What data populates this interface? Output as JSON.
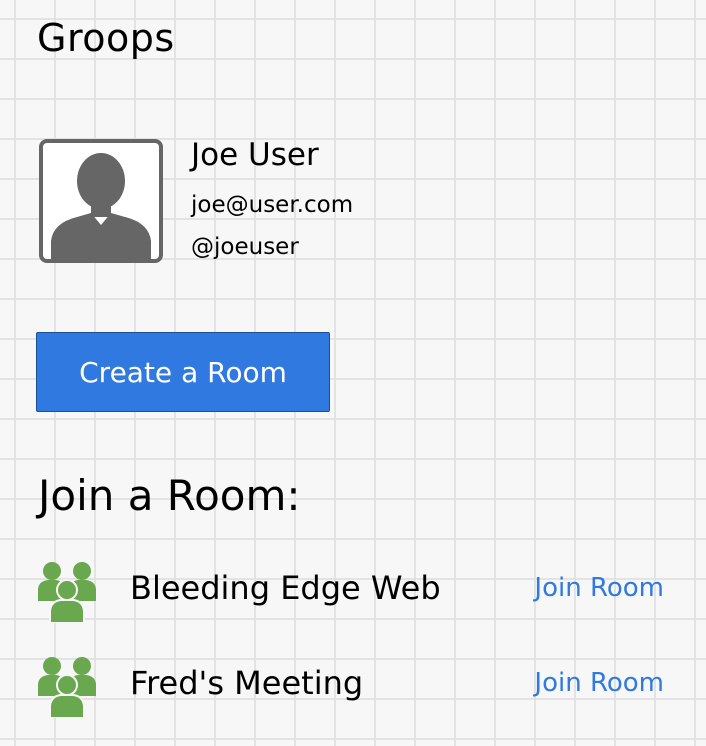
{
  "app": {
    "title": "Groops"
  },
  "profile": {
    "name": "Joe User",
    "email": "joe@user.com",
    "handle": "@joeuser",
    "avatar_icon": "user-silhouette-icon"
  },
  "actions": {
    "create_room_label": "Create a Room"
  },
  "join_section": {
    "title": "Join a Room:",
    "rooms": [
      {
        "name": "Bleeding Edge Web",
        "action_label": "Join Room",
        "icon": "group-icon"
      },
      {
        "name": "Fred's Meeting",
        "action_label": "Join Room",
        "icon": "group-icon"
      }
    ]
  },
  "colors": {
    "accent": "#3079e0",
    "group_icon": "#6aa84f",
    "avatar": "#666666"
  }
}
